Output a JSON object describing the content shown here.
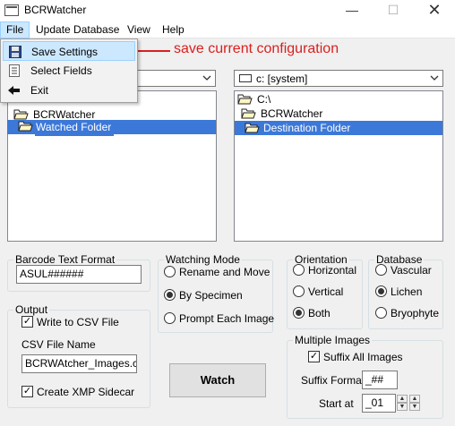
{
  "window": {
    "title": "BCRWatcher",
    "minimize": "—",
    "maximize": "☐",
    "close": "✕"
  },
  "menubar": {
    "file": "File",
    "update_database": "Update Database",
    "view": "View",
    "help": "Help"
  },
  "file_menu": {
    "items": [
      {
        "label": "Save Settings",
        "icon": "save-disk-icon"
      },
      {
        "label": "Select Fields",
        "icon": "list-icon"
      },
      {
        "label": "Exit",
        "icon": "exit-arrow-icon"
      }
    ]
  },
  "annotation": {
    "text": "save current configuration",
    "color": "#d9201f"
  },
  "source": {
    "drive": "",
    "tree": [
      {
        "label": "BCRWatcher"
      },
      {
        "label": "Watched Folder",
        "selected": true
      }
    ]
  },
  "destination": {
    "drive": "c: [system]",
    "tree": [
      {
        "label": "C:\\"
      },
      {
        "label": "BCRWatcher"
      },
      {
        "label": "Destination Folder",
        "selected": true
      }
    ]
  },
  "barcode": {
    "title": "Barcode Text Format",
    "value": "ASUL######"
  },
  "watching_mode": {
    "title": "Watching Mode",
    "options": [
      {
        "label": "Rename and Move",
        "selected": false
      },
      {
        "label": "By Specimen",
        "selected": true
      },
      {
        "label": "Prompt Each Image",
        "selected": false
      }
    ]
  },
  "orientation": {
    "title": "Orientation",
    "options": [
      {
        "label": "Horizontal",
        "selected": false
      },
      {
        "label": "Vertical",
        "selected": false
      },
      {
        "label": "Both",
        "selected": true
      }
    ]
  },
  "database": {
    "title": "Database",
    "options": [
      {
        "label": "Vascular",
        "selected": false
      },
      {
        "label": "Lichen",
        "selected": true
      },
      {
        "label": "Bryophyte",
        "selected": false
      }
    ]
  },
  "output": {
    "title": "Output",
    "write_csv": {
      "label": "Write to CSV File",
      "checked": true
    },
    "csv_label": "CSV File Name",
    "csv_value": "BCRWAtcher_Images.csv",
    "xmp": {
      "label": "Create XMP Sidecar",
      "checked": true
    }
  },
  "watch_button": "Watch",
  "multiple_images": {
    "title": "Multiple Images",
    "suffix_all": {
      "label": "Suffix All Images",
      "checked": true
    },
    "suffix_format_label": "Suffix Format",
    "suffix_format_value": "_##",
    "start_at_label": "Start at",
    "start_at_value": "_01"
  },
  "colors": {
    "selection": "#3c78d8",
    "menu_highlight": "#cce8ff",
    "annotation": "#d9201f"
  }
}
